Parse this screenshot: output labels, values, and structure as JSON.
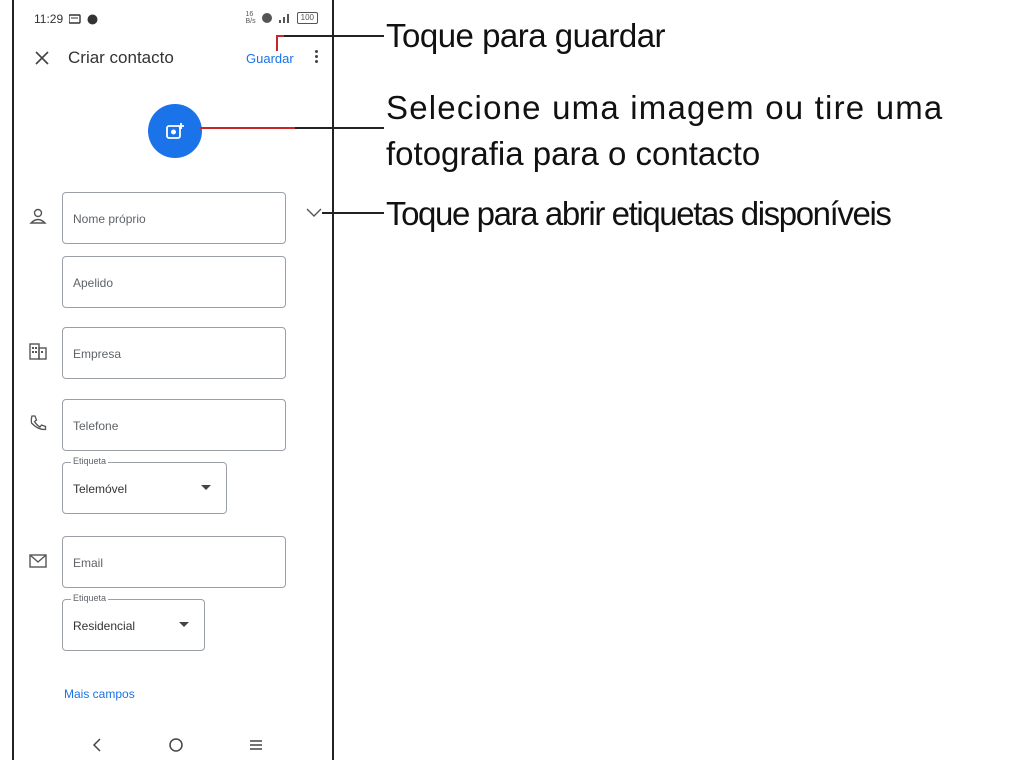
{
  "status_bar": {
    "time": "11:29",
    "network_speed": "16\nB/s",
    "battery": "100"
  },
  "app_bar": {
    "title": "Criar contacto",
    "save_label": "Guardar"
  },
  "form": {
    "first_name_placeholder": "Nome próprio",
    "last_name_placeholder": "Apelido",
    "company_placeholder": "Empresa",
    "phone_placeholder": "Telefone",
    "phone_label_caption": "Etiqueta",
    "phone_label_value": "Telemóvel",
    "email_placeholder": "Email",
    "email_label_caption": "Etiqueta",
    "email_label_value": "Residencial",
    "more_fields": "Mais campos"
  },
  "callouts": {
    "save": "Toque para guardar",
    "photo_line1": "Selecione uma imagem ou tire uma",
    "photo_line2": "fotografia para o contacto",
    "labels": "Toque para abrir etiquetas disponíveis"
  },
  "colors": {
    "accent": "#1a73e8",
    "callout_line": "#c62828"
  }
}
